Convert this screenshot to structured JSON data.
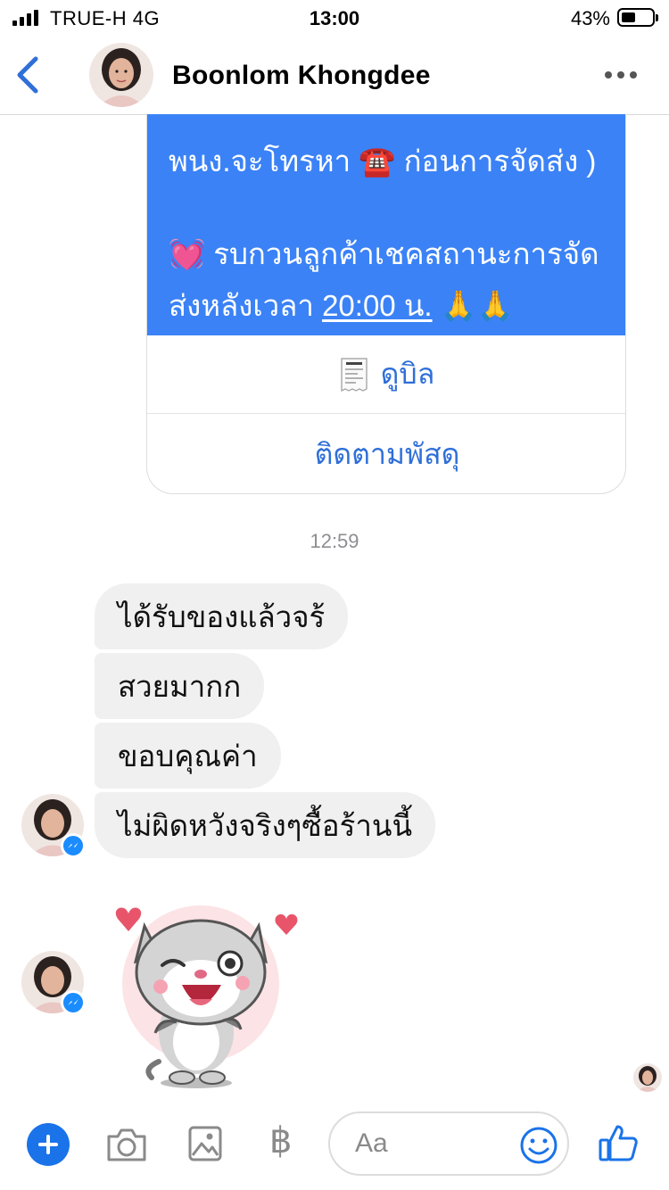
{
  "status_bar": {
    "carrier": "TRUE-H  4G",
    "time": "13:00",
    "battery_percent": "43%",
    "battery_level": 0.43
  },
  "header": {
    "contact_name": "Boonlom Khongdee"
  },
  "card": {
    "line1": "พนง.จะโทรหา ☎️ ก่อนการจัดส่ง )",
    "line2": "💓 รบกวนลูกค้าเชคสถานะการจัด",
    "line3_prefix": "ส่งหลังเวลา ",
    "line3_time": "20:00 น.",
    "line3_suffix": " 🙏🙏",
    "view_bill_label": "ดูบิล",
    "track_parcel_label": "ติดตามพัสดุ"
  },
  "conversation": {
    "timestamp": "12:59",
    "messages": [
      "ได้รับของแล้วจร้",
      "สวยมากก",
      "ขอบคุณค่า",
      "ไม่ผิดหวังจริงๆซื้อร้านนี้"
    ]
  },
  "composer": {
    "placeholder": "Aa",
    "currency_symbol": "฿"
  },
  "colors": {
    "accent": "#1a73e8",
    "card_blue": "#3b82f6",
    "bubble_gray": "#f0f0f0"
  },
  "icons": [
    "back-icon",
    "more-icon",
    "receipt-icon",
    "plus-icon",
    "camera-icon",
    "gallery-icon",
    "baht-icon",
    "emoji-icon",
    "like-icon",
    "messenger-icon"
  ]
}
